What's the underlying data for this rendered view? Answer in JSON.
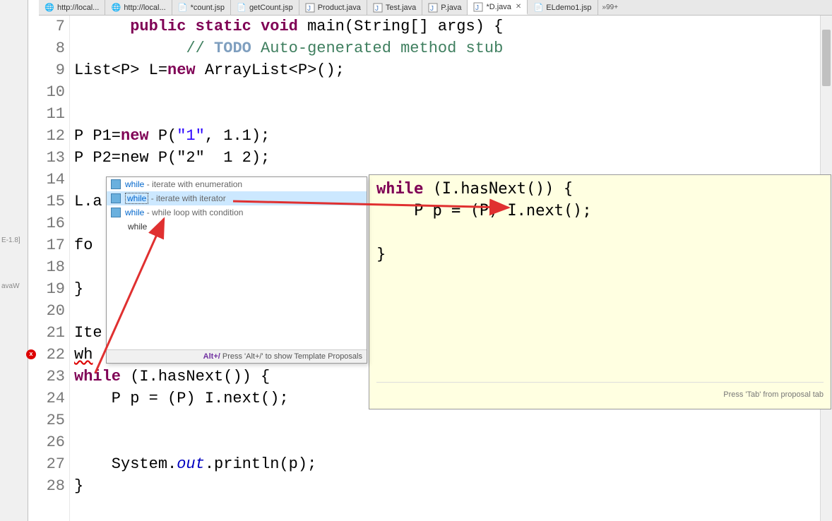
{
  "tabs": [
    {
      "label": "http://local...",
      "icon": "globe"
    },
    {
      "label": "http://local...",
      "icon": "globe"
    },
    {
      "label": "*count.jsp",
      "icon": "jsp"
    },
    {
      "label": "getCount.jsp",
      "icon": "jsp"
    },
    {
      "label": "Product.java",
      "icon": "java"
    },
    {
      "label": "Test.java",
      "icon": "java"
    },
    {
      "label": "P.java",
      "icon": "java"
    },
    {
      "label": "*D.java",
      "icon": "java",
      "active": true,
      "closable": true
    },
    {
      "label": "ELdemo1.jsp",
      "icon": "jsp"
    }
  ],
  "tab_overflow": "»99+",
  "sidebar": {
    "text1": "E-1.8]",
    "text2": "avaW"
  },
  "lines": {
    "l7_indent": "      ",
    "l7_kw1": "public",
    "l7_kw2": "static",
    "l7_kw3": "void",
    "l7_rest": " main(String[] args) {",
    "l8_indent": "            ",
    "l8_comment": "// ",
    "l8_todo": "TODO",
    "l8_rest": " Auto-generated method stub",
    "l9": "List<P> L=",
    "l9_kw": "new",
    "l9_rest": " ArrayList<P>();",
    "l10": "",
    "l11": "",
    "l12": "P P1=",
    "l12_kw": "new",
    "l12_rest1": " P(",
    "l12_str": "\"1\"",
    "l12_rest2": ", 1.1);",
    "l13": "P P2=new P(\"2\"  1 2);",
    "l14": "",
    "l15": "L.a",
    "l16": "",
    "l17": "fo",
    "l18": "",
    "l19": "}",
    "l20": "",
    "l21": "Ite",
    "l22": "wh",
    "l23_kw": "while",
    "l23_rest": " (I.hasNext()) {",
    "l24_indent": "    P p = (P) I.next();",
    "l25": "",
    "l26": "",
    "l27_indent": "    System.",
    "l27_out": "out",
    "l27_rest": ".println(p);",
    "l28": "}"
  },
  "line_numbers": [
    "7",
    "8",
    "9",
    "10",
    "11",
    "12",
    "13",
    "14",
    "15",
    "16",
    "17",
    "18",
    "19",
    "20",
    "21",
    "22",
    "23",
    "24",
    "25",
    "26",
    "27",
    "28"
  ],
  "autocomplete": {
    "items": [
      {
        "label": "while",
        "desc": " - iterate with enumeration"
      },
      {
        "label": "while",
        "desc": " - iterate with iterator",
        "selected": true
      },
      {
        "label": "while",
        "desc": " - while loop with condition"
      },
      {
        "plain": "while"
      }
    ],
    "footer_alt": "Alt+/",
    "footer_text": " Press 'Alt+/' to show Template Proposals"
  },
  "doc": {
    "line1_kw": "while",
    "line1_rest": " (I.hasNext()) {",
    "line2": "    P p = (P) I.next();",
    "line3": "    ",
    "line4": "}",
    "footer": "Press 'Tab' from proposal tab"
  }
}
